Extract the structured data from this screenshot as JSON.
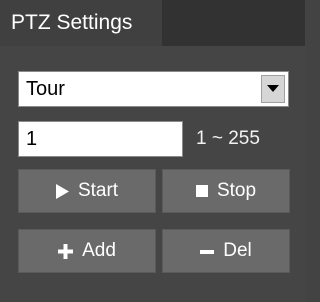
{
  "panel": {
    "title": "PTZ Settings"
  },
  "mode_select": {
    "value": "Tour"
  },
  "tour_number": {
    "value": "1",
    "range": "1 ~ 255"
  },
  "buttons": {
    "start": "Start",
    "stop": "Stop",
    "add": "Add",
    "del": "Del"
  }
}
